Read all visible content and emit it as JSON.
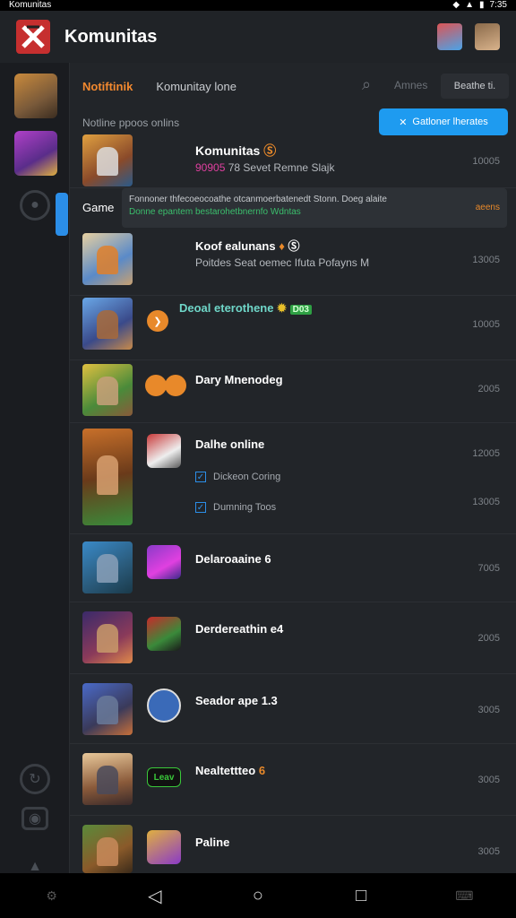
{
  "statusbar": {
    "left": "Komunitas",
    "time": "7:35"
  },
  "app": {
    "title": "Komunitas"
  },
  "tabs": {
    "active": "Notiftinik",
    "second": "Komunitay lone",
    "search_label": "Amnes",
    "right_button": "Beathe ti."
  },
  "section": {
    "heading": "Notline ppoos onlins",
    "primary_button": "Gatloner lherates"
  },
  "game_label": "Game",
  "notice": {
    "line1": "Fonnoner thfecoeocoathe otcanmoerbatenedt Stonn. Doeg alaite",
    "line2": "Donne epantem bestarohetbnernfo Wdntas",
    "count": "aeens"
  },
  "rows": [
    {
      "title": "Komunitas",
      "title_icon": "Ⓢ",
      "sub_pink": "90905",
      "sub": "78  Sevet Remne Slajk",
      "num": "10005"
    },
    {
      "title": "Koof ealunans",
      "title_icon": "Ⓢ",
      "sub": "Poitdes Seat oemec Ifuta Pofayns M",
      "num": "13005"
    },
    {
      "title": "Deoal eterothene",
      "badge": "D03",
      "num": "10005",
      "dot": "❯"
    },
    {
      "title": "Dary Mnenodeg",
      "num": "2005"
    },
    {
      "title": "Dalhe online",
      "num": "12005",
      "num2": "13005",
      "checks": [
        "Dickeon Coring",
        "Dumning Toos"
      ]
    },
    {
      "title": "Delaroaaine 6",
      "num": "7005"
    },
    {
      "title": "Derdereathin e4",
      "num": "2005"
    },
    {
      "title": "Seador ape 1.3",
      "num": "3005"
    },
    {
      "title": "Nealtettteo",
      "title_icon": "6",
      "chip_text": "Leav",
      "num": "3005"
    },
    {
      "title": "Paline",
      "num": "3005"
    }
  ],
  "colors": {
    "accent": "#f3892f",
    "primary": "#1e9bf0",
    "background": "#1d2024"
  }
}
